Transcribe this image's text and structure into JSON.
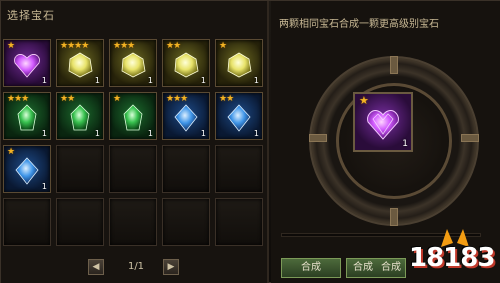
{
  "left_panel": {
    "title": "选择宝石",
    "pager": {
      "prev": "◀",
      "next": "▶",
      "page": "1/1"
    }
  },
  "inventory": [
    {
      "color": "purple",
      "stars": "★",
      "count": "1"
    },
    {
      "color": "yellow",
      "stars": "★★★★",
      "count": "1"
    },
    {
      "color": "yellow",
      "stars": "★★★",
      "count": "1"
    },
    {
      "color": "yellow",
      "stars": "★★",
      "count": "1"
    },
    {
      "color": "yellow",
      "stars": "★",
      "count": "1"
    },
    {
      "color": "green",
      "stars": "★★★",
      "count": "1"
    },
    {
      "color": "green",
      "stars": "★★",
      "count": "1"
    },
    {
      "color": "green",
      "stars": "★",
      "count": "1"
    },
    {
      "color": "blue",
      "stars": "★★★",
      "count": "1"
    },
    {
      "color": "blue",
      "stars": "★★",
      "count": "1"
    },
    {
      "color": "blue",
      "stars": "★",
      "count": "1"
    }
  ],
  "right_panel": {
    "title": "两颗相同宝石合成一颗更高级别宝石",
    "result": {
      "color": "purple",
      "stars": "★",
      "count": "1"
    },
    "buttons": {
      "compose": "合成",
      "compose_a": "合成",
      "compose_b": "合成"
    }
  },
  "watermark": {
    "text": "18183"
  },
  "colors": {
    "purple": "#c44df0",
    "yellow": "#e8e36a",
    "green": "#38c24f",
    "blue": "#3f95e8",
    "star": "#f3b323"
  }
}
